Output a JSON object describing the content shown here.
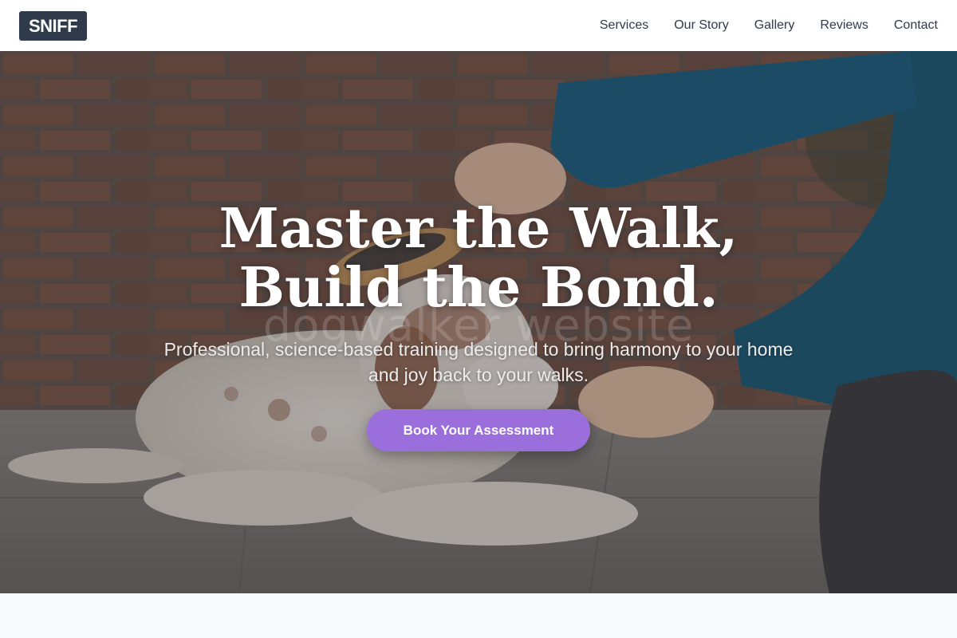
{
  "header": {
    "logo": "SNIFF",
    "nav": [
      "Services",
      "Our Story",
      "Gallery",
      "Reviews",
      "Contact"
    ]
  },
  "hero": {
    "title": "Master the Walk, Build the Bond.",
    "subtitle": "Professional, science-based training designed to bring harmony to your home and joy back to your walks.",
    "cta_label": "Book Your Assessment",
    "watermark": "dogwalker website"
  },
  "colors": {
    "logo_bg": "#2f3a4b",
    "cta": "#9a6fdc",
    "page_bg": "#f8f9fd"
  }
}
